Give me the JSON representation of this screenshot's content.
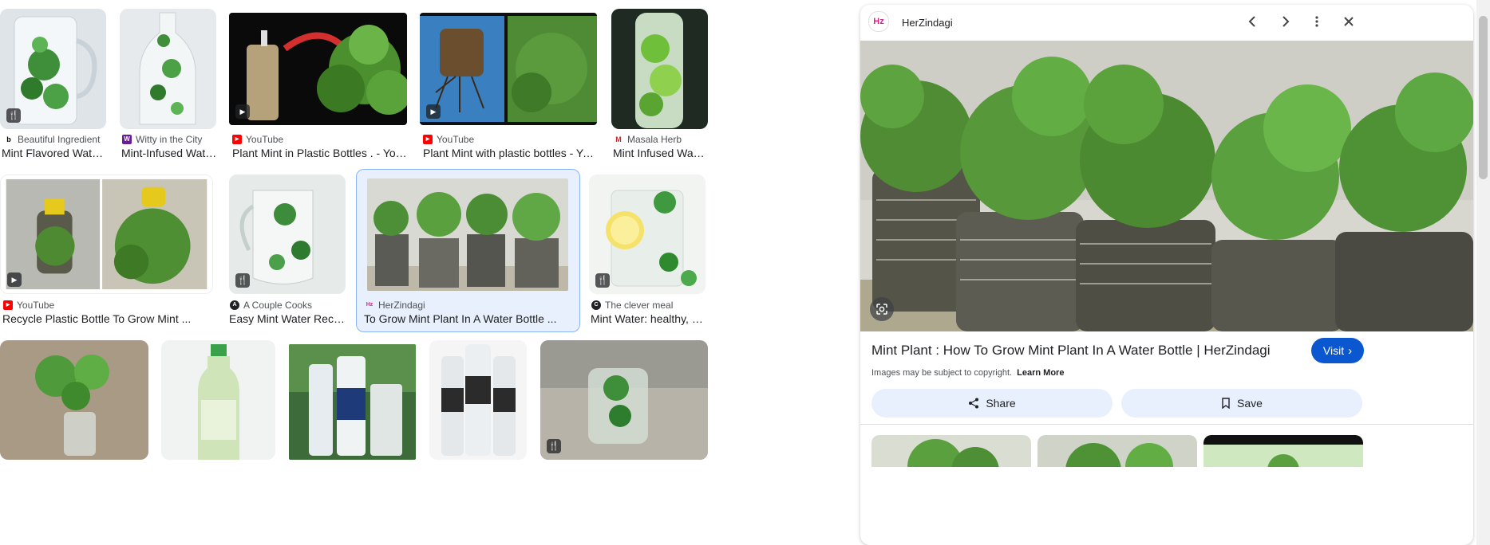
{
  "results": [
    {
      "source": "Beautiful Ingredient",
      "title": "Mint Flavored Water ...",
      "badge": "fork-knife-icon",
      "favicon": "b"
    },
    {
      "source": "Witty in the City",
      "title": "Mint-Infused Water...",
      "badge": "",
      "favicon": "W"
    },
    {
      "source": "YouTube",
      "title": "Plant Mint in Plastic Bottles . - YouTube",
      "badge": "play-icon",
      "favicon": "▶"
    },
    {
      "source": "YouTube",
      "title": "Plant Mint with plastic bottles - YouTube",
      "badge": "play-icon",
      "favicon": "▶"
    },
    {
      "source": "Masala Herb",
      "title": "Mint Infused Water...",
      "badge": "",
      "favicon": "M"
    },
    {
      "source": "YouTube",
      "title": "Recycle Plastic Bottle To Grow Mint ...",
      "badge": "play-icon",
      "favicon": "▶"
    },
    {
      "source": "A Couple Cooks",
      "title": "Easy Mint Water Recipe ...",
      "badge": "fork-knife-icon",
      "favicon": "A"
    },
    {
      "source": "HerZindagi",
      "title": "To Grow Mint Plant In A Water Bottle ...",
      "badge": "",
      "favicon": "Hz"
    },
    {
      "source": "The clever meal",
      "title": "Mint Water: healthy, eas...",
      "badge": "fork-knife-icon",
      "favicon": "C"
    }
  ],
  "badges": {
    "play": "▶",
    "recipe": "🍴"
  },
  "panel": {
    "site_name": "HerZindagi",
    "site_logo": "Hz",
    "title": "Mint Plant : How To Grow Mint Plant In A Water Bottle | HerZindagi",
    "visit_label": "Visit",
    "copyright_note": "Images may be subject to copyright.",
    "learn_more": "Learn More",
    "share_label": "Share",
    "save_label": "Save",
    "visit_chevron": "›"
  },
  "colors": {
    "accent": "#0b57d0",
    "selected_bg": "#e8f0fe",
    "selected_border": "#8ab4f8",
    "youtube": "#ff0000",
    "herzindagi": "#e0218a"
  }
}
